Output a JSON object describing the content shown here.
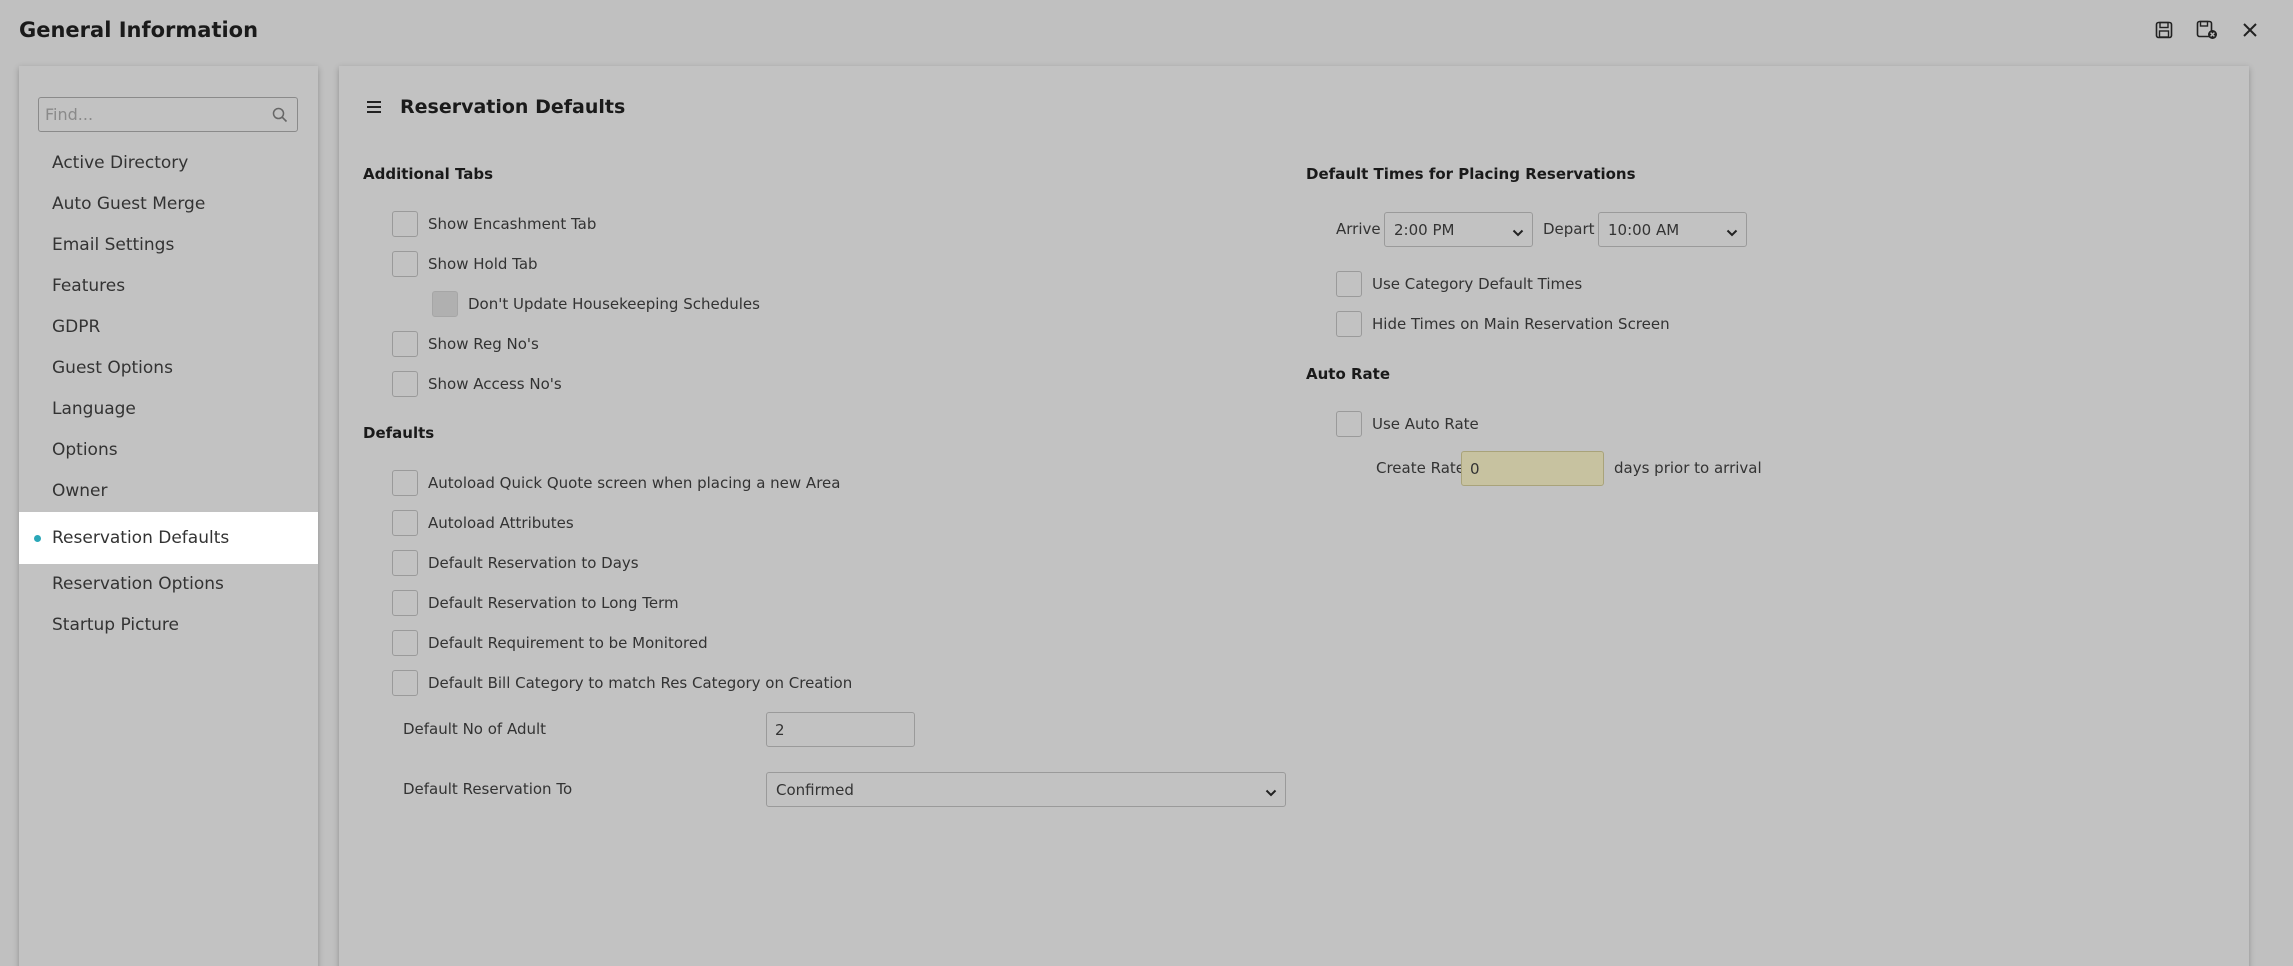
{
  "window": {
    "title": "General Information",
    "actions": {
      "save_icon": "save-icon",
      "save_close_icon": "save-close-icon",
      "close_icon": "close-icon"
    }
  },
  "sidebar": {
    "search_placeholder": "Find...",
    "items": [
      {
        "label": "Active Directory"
      },
      {
        "label": "Auto Guest Merge"
      },
      {
        "label": "Email Settings"
      },
      {
        "label": "Features"
      },
      {
        "label": "GDPR"
      },
      {
        "label": "Guest Options"
      },
      {
        "label": "Language"
      },
      {
        "label": "Options"
      },
      {
        "label": "Owner"
      },
      {
        "label": "Reservation Defaults",
        "active": true
      },
      {
        "label": "Reservation Options"
      },
      {
        "label": "Startup Picture"
      }
    ],
    "accent_color": "#2aa7b8"
  },
  "main": {
    "title": "Reservation Defaults",
    "additional_tabs": {
      "heading": "Additional Tabs",
      "show_encashment_tab": "Show Encashment Tab",
      "show_hold_tab": "Show Hold Tab",
      "dont_update_housekeeping": "Don't Update Housekeeping Schedules",
      "show_reg_nos": "Show Reg No's",
      "show_access_nos": "Show Access No's"
    },
    "defaults": {
      "heading": "Defaults",
      "autoload_quick_quote": "Autoload Quick Quote screen when placing a new Area",
      "autoload_attributes": "Autoload Attributes",
      "default_res_days": "Default Reservation to Days",
      "default_res_long_term": "Default Reservation to Long Term",
      "default_req_monitored": "Default Requirement to be Monitored",
      "default_bill_category": "Default Bill Category to match Res Category on Creation",
      "default_no_adult_label": "Default No of Adult",
      "default_no_adult_value": "2",
      "default_reservation_to_label": "Default Reservation To",
      "default_reservation_to_value": "Confirmed"
    },
    "default_times": {
      "heading": "Default Times for Placing Reservations",
      "arrive_label": "Arrive",
      "arrive_value": "2:00 PM",
      "depart_label": "Depart",
      "depart_value": "10:00 AM",
      "use_category_default_times": "Use Category Default Times",
      "hide_times_main": "Hide Times on Main Reservation Screen"
    },
    "auto_rate": {
      "heading": "Auto Rate",
      "use_auto_rate": "Use Auto Rate",
      "create_rate_label": "Create Rate",
      "create_rate_value": "0",
      "days_prior_label": "days prior to arrival"
    }
  }
}
